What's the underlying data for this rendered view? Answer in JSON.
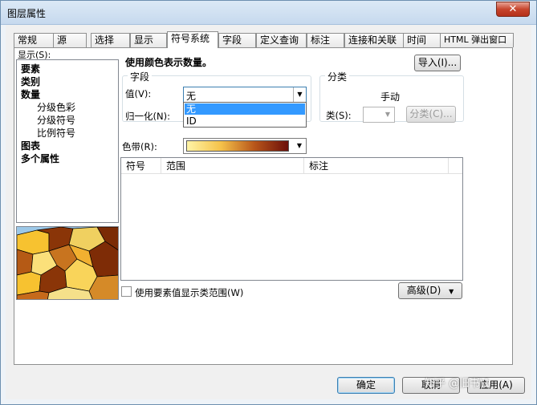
{
  "window": {
    "title": "图层属性",
    "close_glyph": "✕"
  },
  "tabs": [
    {
      "label": "常规"
    },
    {
      "label": "源"
    },
    {
      "label": "选择"
    },
    {
      "label": "显示"
    },
    {
      "label": "符号系统"
    },
    {
      "label": "字段"
    },
    {
      "label": "定义查询"
    },
    {
      "label": "标注"
    },
    {
      "label": "连接和关联"
    },
    {
      "label": "时间"
    },
    {
      "label": "HTML 弹出窗口"
    }
  ],
  "show": {
    "label": "显示(S):",
    "items": [
      {
        "label": "要素",
        "bold": true
      },
      {
        "label": "类别",
        "bold": true
      },
      {
        "label": "数量",
        "bold": true
      },
      {
        "label": "分级色彩",
        "bold": false
      },
      {
        "label": "分级符号",
        "bold": false
      },
      {
        "label": "比例符号",
        "bold": false
      },
      {
        "label": "图表",
        "bold": true
      },
      {
        "label": "多个属性",
        "bold": true
      }
    ]
  },
  "heading": "使用颜色表示数量。",
  "import_button": "导入(I)...",
  "fields_group": {
    "title": "字段",
    "value_label": "值(V):",
    "value_selected": "无",
    "normalize_label": "归一化(N):",
    "dropdown_options": [
      "无",
      "ID"
    ]
  },
  "classify_group": {
    "title": "分类",
    "method": "手动",
    "classes_label": "类(S):",
    "classify_button": "分类(C)..."
  },
  "color_ramp": {
    "label": "色带(R):",
    "colors": [
      "#fff4a6",
      "#f5c24a",
      "#b8561a",
      "#6b0f0a"
    ]
  },
  "table": {
    "columns": [
      "符号",
      "范围",
      "标注"
    ]
  },
  "use_feature_values_label": "使用要素值显示类范围(W)",
  "advanced_button": "高级(D)",
  "footer": {
    "ok": "确定",
    "cancel": "取消",
    "apply": "应用(A)"
  },
  "watermark": "知乎 @旧书\\1"
}
